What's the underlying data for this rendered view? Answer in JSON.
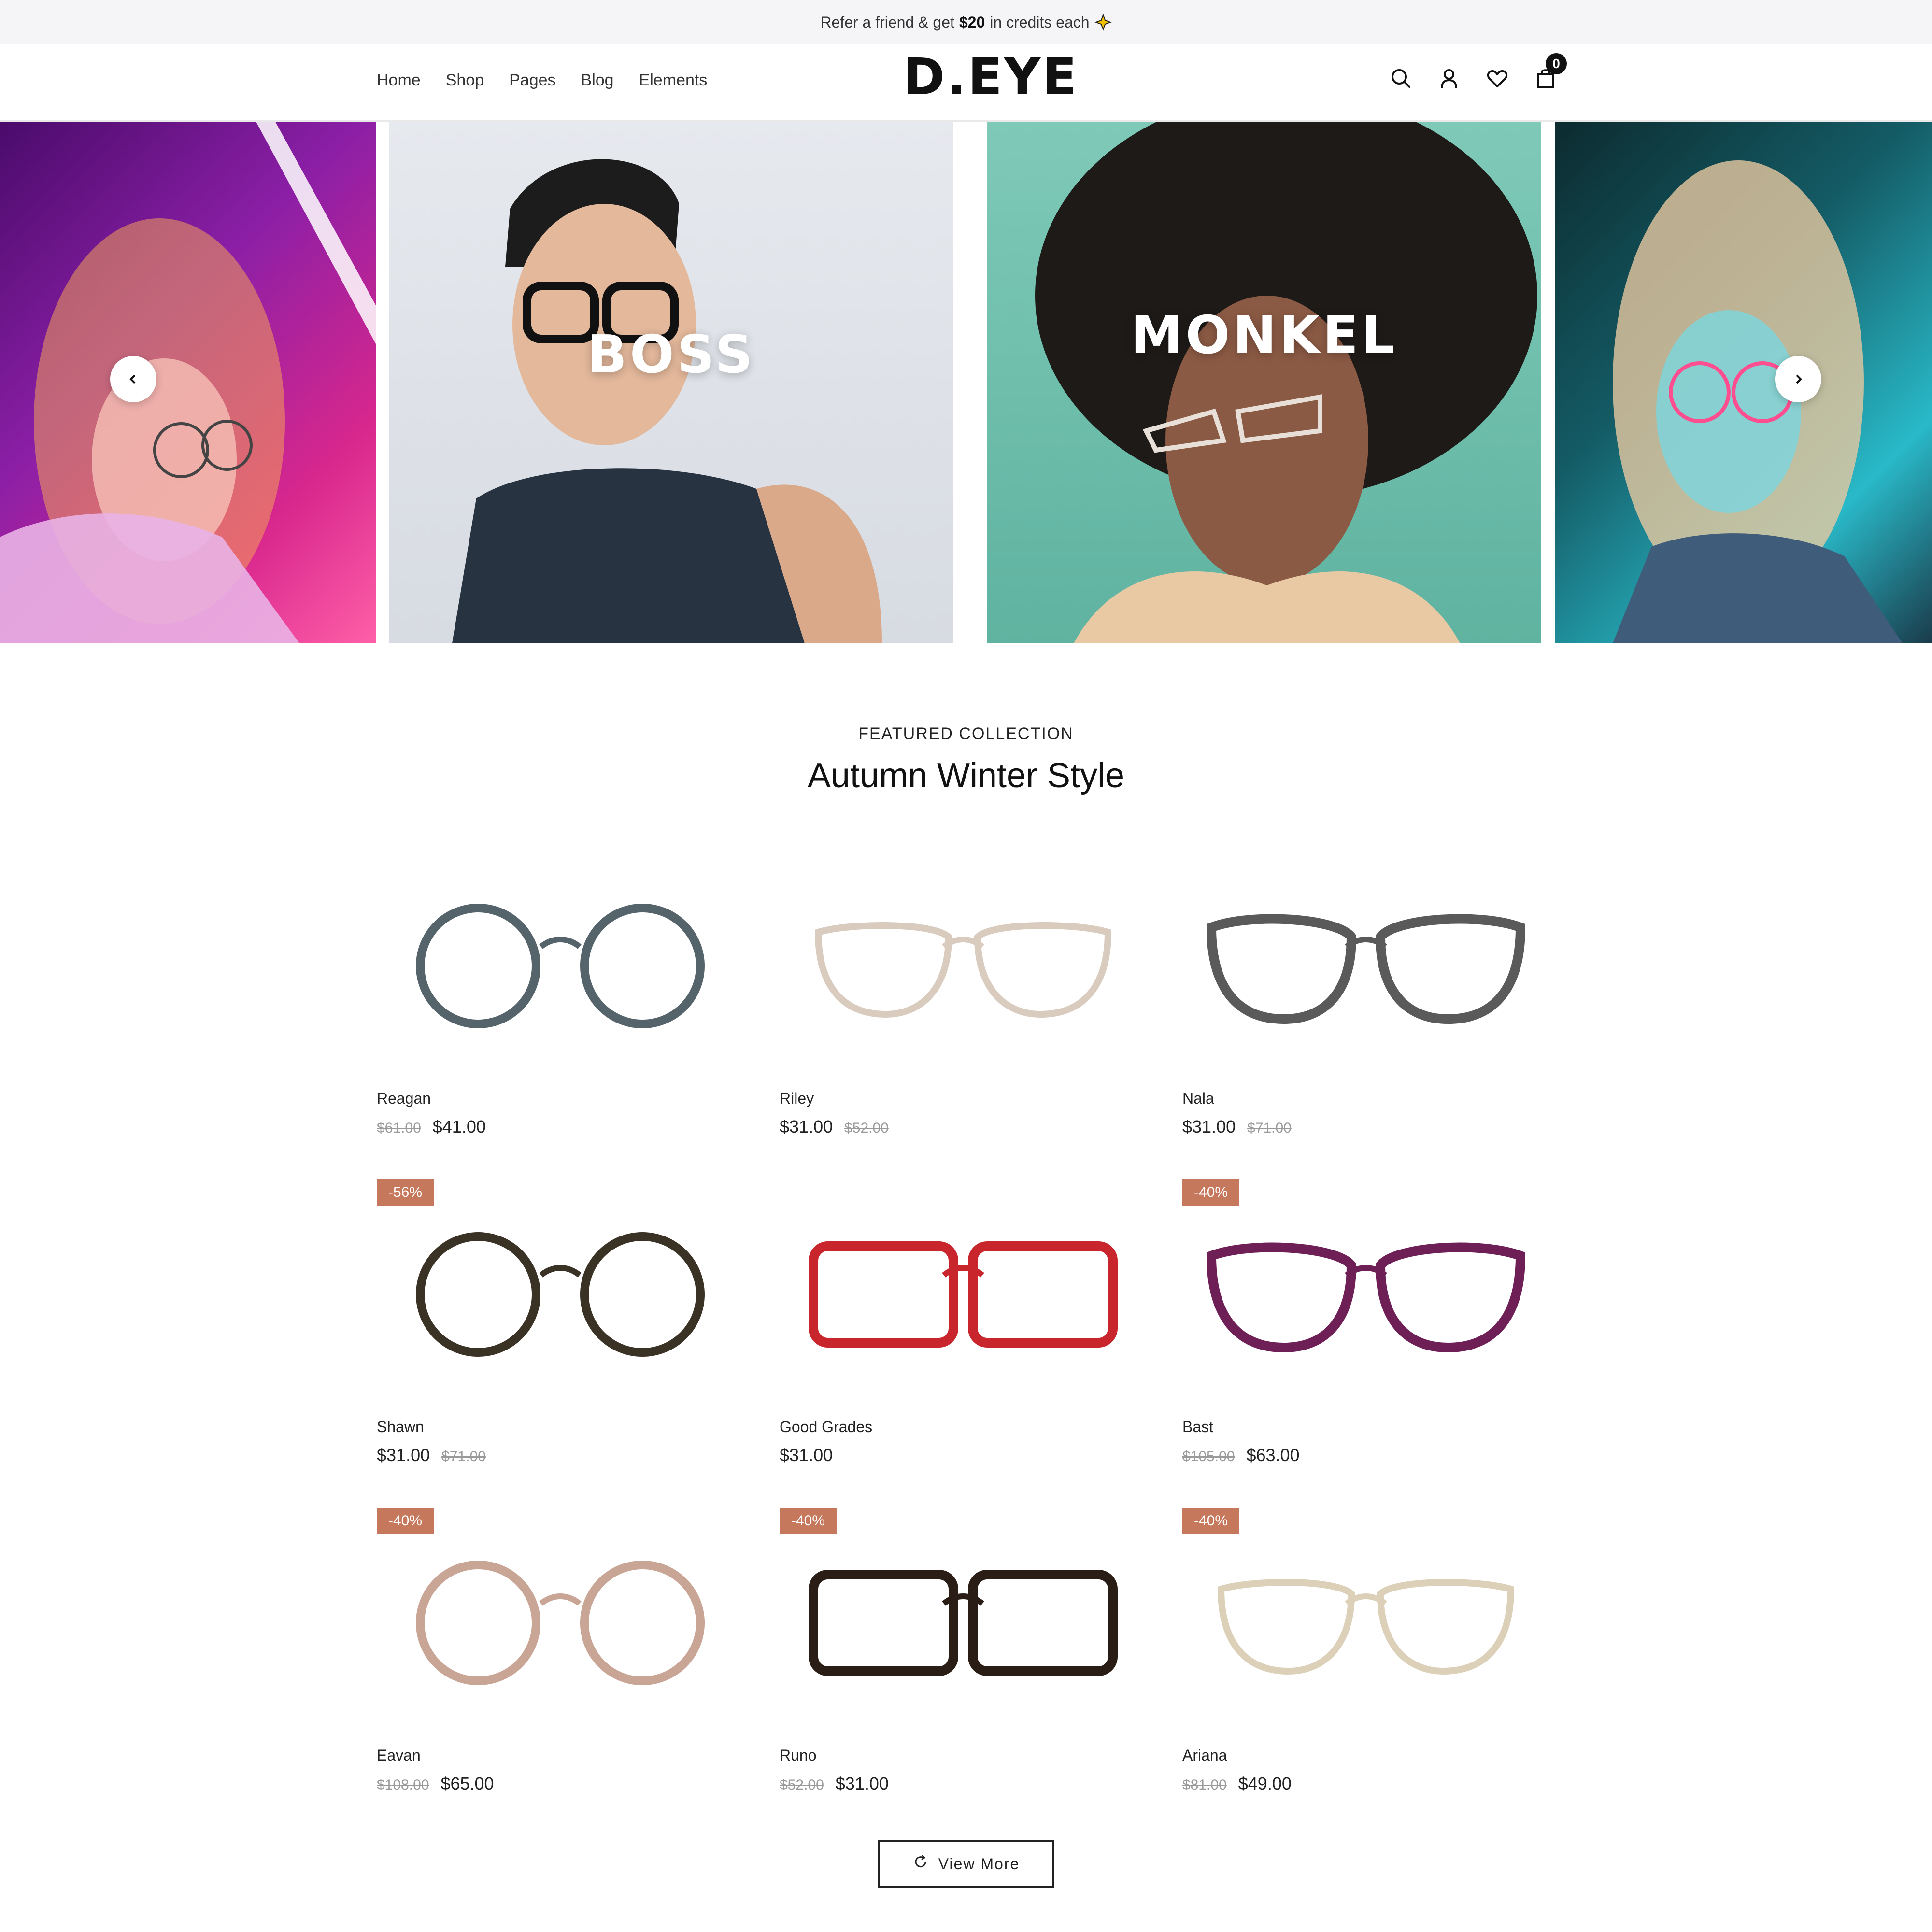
{
  "announcement": {
    "prefix": "Refer a friend & get",
    "amount": "$20",
    "suffix": "in credits each"
  },
  "header": {
    "nav": [
      "Home",
      "Shop",
      "Pages",
      "Blog",
      "Elements"
    ],
    "logo": "D.EYE",
    "cart_count": "0",
    "icons": [
      "search-icon",
      "user-icon",
      "heart-icon",
      "bag-icon"
    ]
  },
  "hero": {
    "slides": [
      {
        "label": ""
      },
      {
        "label": "BOSS"
      },
      {
        "label": "MONKEL"
      },
      {
        "label": ""
      }
    ]
  },
  "section": {
    "eyebrow": "FEATURED COLLECTION",
    "title": "Autumn Winter Style"
  },
  "products": [
    {
      "name": "Reagan",
      "old_price": "$61.00",
      "price": "$41.00",
      "badge": "",
      "frame_color": "#55636a",
      "style": "round"
    },
    {
      "name": "Riley",
      "old_price": "$52.00",
      "price": "$31.00",
      "badge": "",
      "frame_color": "#d9cbbd",
      "style": "soft"
    },
    {
      "name": "Nala",
      "old_price": "$71.00",
      "price": "$31.00",
      "badge": "",
      "frame_color": "#5a5a5a",
      "style": "cat"
    },
    {
      "name": "Shawn",
      "old_price": "$71.00",
      "price": "$31.00",
      "badge": "-56%",
      "frame_color": "#3b3226",
      "style": "round"
    },
    {
      "name": "Good Grades",
      "old_price": "",
      "price": "$31.00",
      "badge": "",
      "frame_color": "#c8262c",
      "style": "rect"
    },
    {
      "name": "Bast",
      "old_price": "$105.00",
      "price": "$63.00",
      "badge": "-40%",
      "frame_color": "#6e1f55",
      "style": "cat"
    },
    {
      "name": "Eavan",
      "old_price": "$108.00",
      "price": "$65.00",
      "badge": "-40%",
      "frame_color": "#c9a596",
      "style": "round"
    },
    {
      "name": "Runo",
      "old_price": "$52.00",
      "price": "$31.00",
      "badge": "-40%",
      "frame_color": "#2a1d16",
      "style": "rect"
    },
    {
      "name": "Ariana",
      "old_price": "$81.00",
      "price": "$49.00",
      "badge": "-40%",
      "frame_color": "#dcd1b8",
      "style": "soft"
    }
  ],
  "view_more": "View More",
  "colors": {
    "badge": "#c6785c",
    "text": "#222222",
    "old_price": "#9a9a9a"
  }
}
